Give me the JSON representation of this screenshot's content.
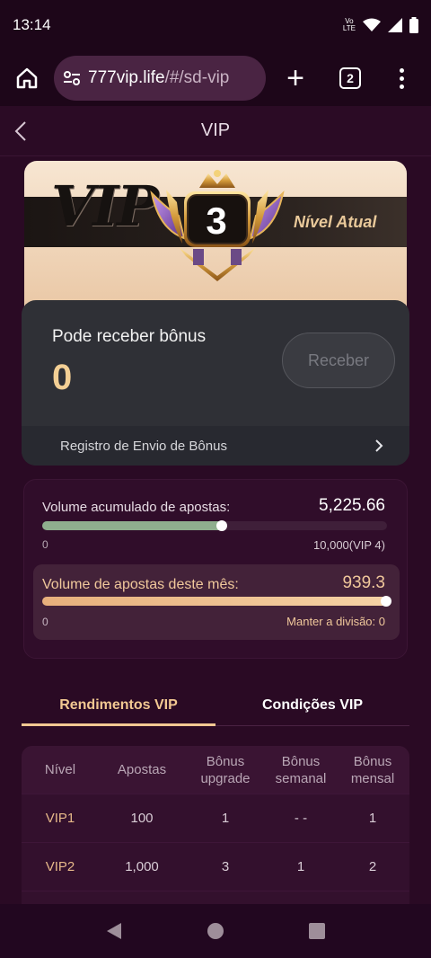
{
  "status_bar": {
    "time": "13:14",
    "volte_top": "Vo",
    "volte_bottom": "LTE",
    "icons": [
      "wifi-icon",
      "signal-icon",
      "battery-icon"
    ]
  },
  "browser": {
    "url_host": "777vip.life",
    "url_path": "/#/sd-vip",
    "tab_count": "2",
    "plus": "+"
  },
  "header": {
    "title": "VIP"
  },
  "vip_card": {
    "vip_word": "VIP",
    "level": "3",
    "level_caption": "Nível Atual"
  },
  "bonus": {
    "label": "Pode receber bônus",
    "value": "0",
    "receive_button": "Receber",
    "registro": "Registro de Envio de Bônus"
  },
  "volume": {
    "accumulated_label": "Volume acumulado de apostas:",
    "accumulated_value": "5,225.66",
    "accumulated_progress": 0.5226,
    "accumulated_min": "0",
    "accumulated_max": "10,000(VIP 4)",
    "month_label": "Volume de apostas deste mês:",
    "month_value": "939.3",
    "month_progress": 1.0,
    "month_min": "0",
    "month_maint": "Manter a divisão: 0"
  },
  "tabs": [
    {
      "label": "Rendimentos VIP",
      "active": true
    },
    {
      "label": "Condições VIP",
      "active": false
    }
  ],
  "table": {
    "headers": [
      "Nível",
      "Apostas",
      "Bônus upgrade",
      "Bônus semanal",
      "Bônus mensal"
    ],
    "rows": [
      [
        "VIP1",
        "100",
        "1",
        "- -",
        "1"
      ],
      [
        "VIP2",
        "1,000",
        "3",
        "1",
        "2"
      ]
    ]
  },
  "colors": {
    "background": "#2a0a24",
    "accent_gold": "#f2c892",
    "progress_green": "#8fae8e"
  }
}
